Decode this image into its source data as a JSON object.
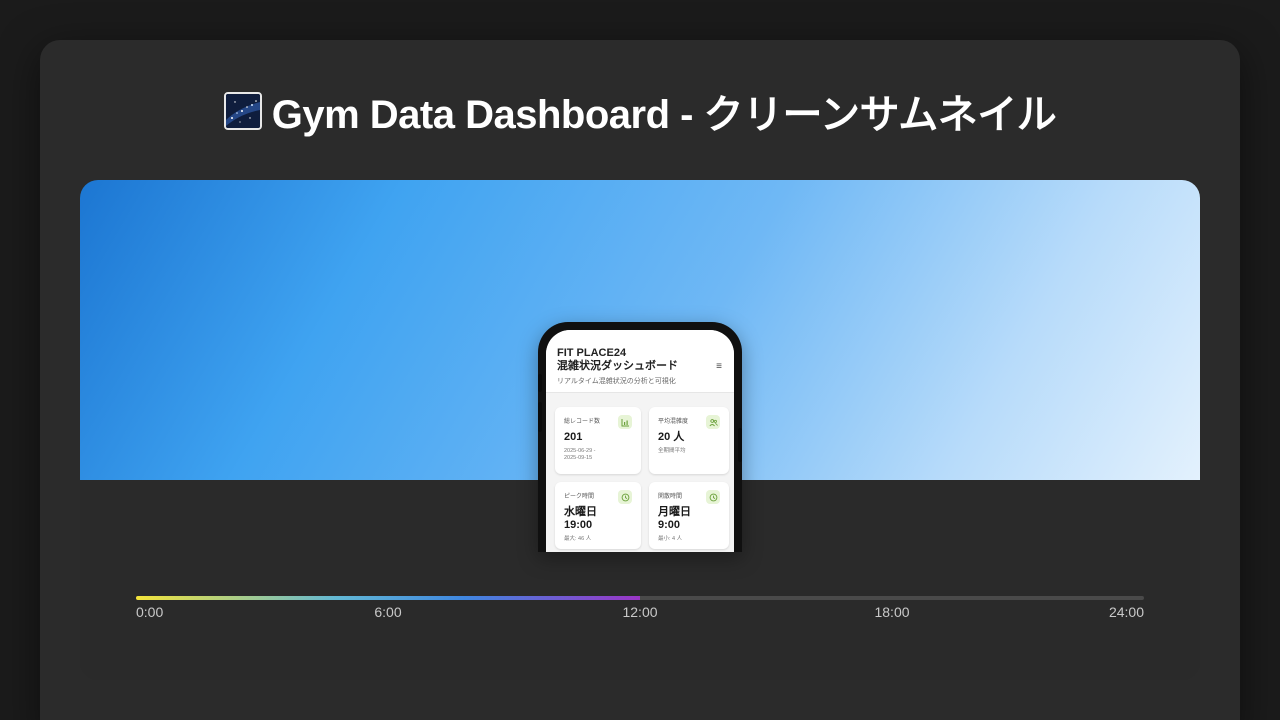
{
  "page": {
    "title": "Gym Data Dashboard - クリーンサムネイル",
    "title_icon": "night-sky-icon"
  },
  "phone": {
    "app_brand": "FIT PLACE24",
    "app_title": "混雑状況ダッシュボード",
    "app_subtitle": "リアルタイム混雑状況の分析と可視化",
    "menu_icon": "hamburger-menu-icon",
    "stats": [
      {
        "label": "総レコード数",
        "value": "201",
        "note": "2025-06-29 - 2025-09-15",
        "icon": "bar-chart-icon"
      },
      {
        "label": "平均混雑度",
        "value": "20 人",
        "note": "全期間平均",
        "icon": "users-icon"
      },
      {
        "label": "ピーク時間",
        "value": "水曜日\n19:00",
        "value_line1": "水曜日",
        "value_line2": "19:00",
        "note": "最大: 46 人",
        "icon": "clock-icon"
      },
      {
        "label": "閑散時間",
        "value": "月曜日\n9:00",
        "value_line1": "月曜日",
        "value_line2": "9:00",
        "note": "最小: 4 人",
        "icon": "clock-icon"
      }
    ]
  },
  "timeline": {
    "progress": 0.5,
    "labels": [
      "0:00",
      "6:00",
      "12:00",
      "18:00",
      "24:00"
    ],
    "gradient_colors": [
      "#f3e33a",
      "#62b8d5",
      "#3f87e0",
      "#9a36c6"
    ]
  },
  "colors": {
    "background": "#1b1b1b",
    "card": "#2b2b2b",
    "hero_start": "#1c76d2",
    "hero_end": "#e3f1fd",
    "badge_bg": "#e7f4d6"
  }
}
